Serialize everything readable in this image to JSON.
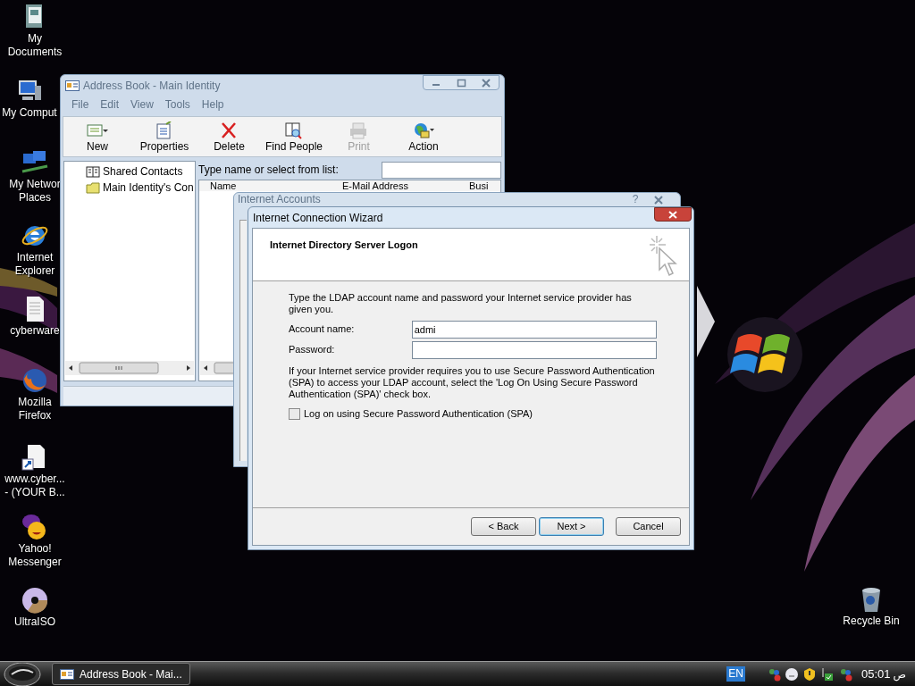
{
  "desktop_icons": [
    {
      "kind": "documents",
      "label": [
        "My",
        "Documents"
      ]
    },
    {
      "kind": "computer",
      "label": [
        "My Comput"
      ]
    },
    {
      "kind": "network",
      "label": [
        "My Networ",
        "Places"
      ]
    },
    {
      "kind": "browser",
      "label": [
        "Internet",
        "Explorer"
      ]
    },
    {
      "kind": "textfile",
      "label": [
        "cyberware"
      ]
    },
    {
      "kind": "firefox",
      "label": [
        "Mozilla",
        "Firefox"
      ]
    },
    {
      "kind": "shortcut",
      "label": [
        "www.cyber...",
        "- (YOUR B..."
      ]
    },
    {
      "kind": "messenger",
      "label": [
        "Yahoo!",
        "Messenger"
      ]
    },
    {
      "kind": "disc",
      "label": [
        "UltraISO"
      ]
    },
    {
      "kind": "recycle",
      "label": [
        "Recycle Bin"
      ]
    }
  ],
  "address_book": {
    "title": "Address Book - Main Identity",
    "active": false,
    "menu": [
      "File",
      "Edit",
      "View",
      "Tools",
      "Help"
    ],
    "toolbar": [
      {
        "kind": "new",
        "label": "New",
        "disabled": false
      },
      {
        "kind": "properties",
        "label": "Properties",
        "disabled": false
      },
      {
        "kind": "delete",
        "label": "Delete",
        "disabled": false
      },
      {
        "kind": "find",
        "label": "Find People",
        "disabled": false
      },
      {
        "kind": "print",
        "label": "Print",
        "disabled": true
      },
      {
        "kind": "action",
        "label": "Action",
        "disabled": false
      }
    ],
    "tree": [
      {
        "kind": "book",
        "label": "Shared Contacts"
      },
      {
        "kind": "folder",
        "label": "Main Identity's Con"
      }
    ],
    "search_label": "Type name or select from list:",
    "columns": [
      "Name",
      "E-Mail Address",
      "Busi"
    ]
  },
  "internet_accounts": {
    "title": "Internet Accounts",
    "active": false,
    "help_button": "?"
  },
  "wizard": {
    "title": "Internet Connection Wizard",
    "active": true,
    "heading": "Internet Directory Server Logon",
    "intro": "Type the LDAP account name and password your Internet service provider has given you.",
    "fields": [
      {
        "label": "Account name:",
        "value": "admi"
      },
      {
        "label": "Password:"
      }
    ],
    "note": "If your Internet service provider requires you to use Secure Password Authentication (SPA) to access your LDAP account, select the 'Log On Using Secure Password Authentication (SPA)' check box.",
    "checkbox": {
      "label": "Log on using Secure Password Authentication (SPA)",
      "checked": false
    },
    "buttons": [
      {
        "label": "< Back",
        "default": false
      },
      {
        "label": "Next >",
        "default": true
      },
      {
        "label": "Cancel",
        "default": false
      }
    ]
  },
  "taskbar": {
    "tasks": [
      {
        "label": "Address Book - Mai...",
        "selected": false
      }
    ],
    "language": "EN",
    "time": "05:01",
    "ampm": "ص"
  }
}
